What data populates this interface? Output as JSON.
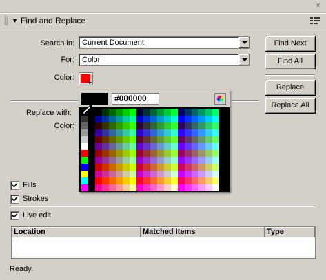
{
  "panel": {
    "title": "Find and Replace",
    "close_glyph": "×"
  },
  "search": {
    "search_in_label": "Search in:",
    "search_in_value": "Current Document",
    "for_label": "For:",
    "for_value": "Color",
    "color_label": "Color:",
    "color_value": "#ff0000"
  },
  "replace": {
    "replace_with_label": "Replace with:",
    "color_label": "Color:"
  },
  "buttons": {
    "find_next": "Find Next",
    "find_all": "Find All",
    "replace": "Replace",
    "replace_all": "Replace All"
  },
  "options": {
    "fills": {
      "label": "Fills",
      "checked": true
    },
    "strokes": {
      "label": "Strokes",
      "checked": true
    },
    "live_edit": {
      "label": "Live edit",
      "checked": true
    }
  },
  "results": {
    "columns": [
      "Location",
      "Matched Items",
      "Type"
    ],
    "rows": []
  },
  "status": "Ready.",
  "color_picker": {
    "hex_value": "#000000",
    "preview_color": "#000000",
    "icons": [
      "eyedropper-icon",
      "color-wheel-icon"
    ]
  }
}
